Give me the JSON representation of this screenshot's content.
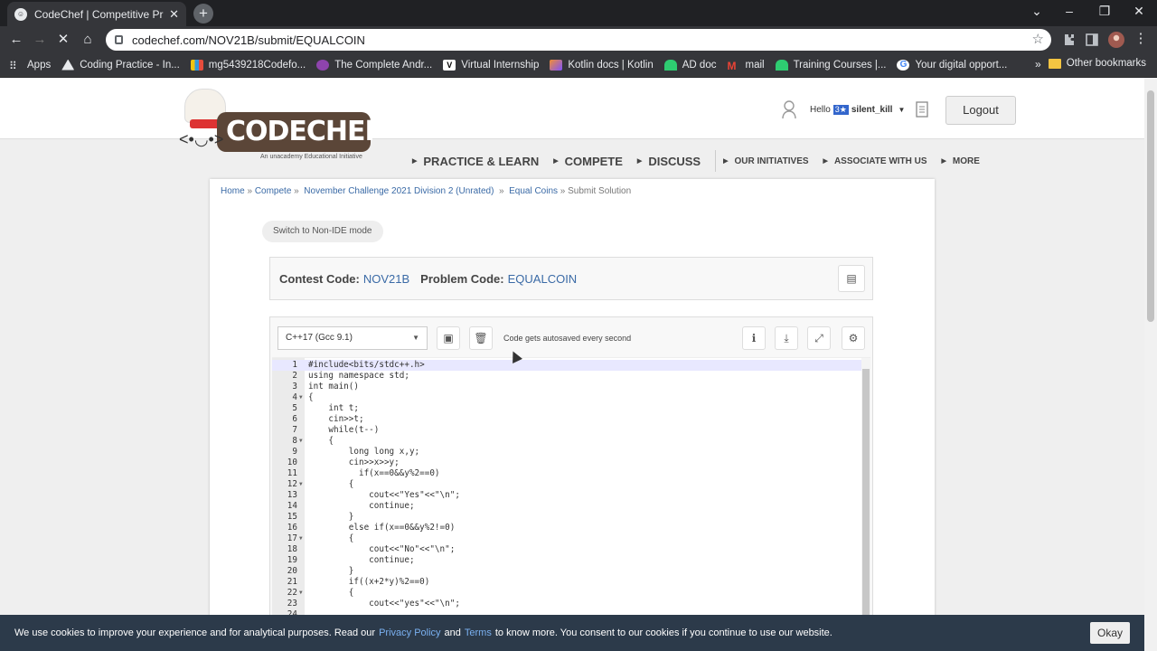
{
  "browser": {
    "tab_title": "CodeChef | Competitive Program",
    "url": "codechef.com/NOV21B/submit/EQUALCOIN",
    "bookmarks": [
      {
        "label": "Apps",
        "color": "#e8eaed"
      },
      {
        "label": "Coding Practice - In...",
        "color": "#e8eaed"
      },
      {
        "label": "mg5439218Codefo...",
        "color": "#e84c3d"
      },
      {
        "label": "The Complete Andr...",
        "color": "#8e44ad"
      },
      {
        "label": "Virtual Internship",
        "color": "#e8eaed"
      },
      {
        "label": "Kotlin docs | Kotlin",
        "color": "#7f52ff"
      },
      {
        "label": "AD doc",
        "color": "#2ecc71"
      },
      {
        "label": "mail",
        "color": "#ea4335"
      },
      {
        "label": "Training Courses  |...",
        "color": "#2ecc71"
      },
      {
        "label": "Your digital opport...",
        "color": "#4285f4"
      }
    ],
    "other_bookmarks": "Other bookmarks"
  },
  "header": {
    "logo_text": "CODECHEF",
    "logo_tagline": "An unacademy Educational Initiative",
    "hello": "Hello",
    "stars": "3★",
    "username": "silent_kill",
    "logout": "Logout"
  },
  "nav": {
    "practice": "PRACTICE & LEARN",
    "compete": "COMPETE",
    "discuss": "DISCUSS",
    "initiatives": "OUR INITIATIVES",
    "associate": "ASSOCIATE WITH US",
    "more": "MORE"
  },
  "breadcrumb": {
    "home": "Home",
    "compete": "Compete",
    "contest": "November Challenge 2021 Division 2 (Unrated)",
    "problem": "Equal Coins",
    "current": "Submit Solution"
  },
  "switch_mode": "Switch to Non-IDE mode",
  "contest": {
    "contest_label": "Contest Code:",
    "contest_code": "NOV21B",
    "problem_label": "Problem Code:",
    "problem_code": "EQUALCOIN"
  },
  "editor": {
    "language": "C++17 (Gcc 9.1)",
    "autosave": "Code gets autosaved every second",
    "lines": [
      {
        "n": "1",
        "fold": false,
        "src": "#include<bits/stdc++.h>"
      },
      {
        "n": "2",
        "fold": false,
        "src": "using namespace std;"
      },
      {
        "n": "3",
        "fold": false,
        "src": "int main()"
      },
      {
        "n": "4",
        "fold": true,
        "src": "{"
      },
      {
        "n": "5",
        "fold": false,
        "src": "    int t;"
      },
      {
        "n": "6",
        "fold": false,
        "src": "    cin>>t;"
      },
      {
        "n": "7",
        "fold": false,
        "src": "    while(t--)"
      },
      {
        "n": "8",
        "fold": true,
        "src": "    {"
      },
      {
        "n": "9",
        "fold": false,
        "src": "        long long x,y;"
      },
      {
        "n": "10",
        "fold": false,
        "src": "        cin>>x>>y;"
      },
      {
        "n": "11",
        "fold": false,
        "src": "          if(x==0&&y%2==0)"
      },
      {
        "n": "12",
        "fold": true,
        "src": "        {"
      },
      {
        "n": "13",
        "fold": false,
        "src": "            cout<<\"Yes\"<<\"\\n\";"
      },
      {
        "n": "14",
        "fold": false,
        "src": "            continue;"
      },
      {
        "n": "15",
        "fold": false,
        "src": "        }"
      },
      {
        "n": "16",
        "fold": false,
        "src": "        else if(x==0&&y%2!=0)"
      },
      {
        "n": "17",
        "fold": true,
        "src": "        {"
      },
      {
        "n": "18",
        "fold": false,
        "src": "            cout<<\"No\"<<\"\\n\";"
      },
      {
        "n": "19",
        "fold": false,
        "src": "            continue;"
      },
      {
        "n": "20",
        "fold": false,
        "src": "        }"
      },
      {
        "n": "21",
        "fold": false,
        "src": "        if((x+2*y)%2==0)"
      },
      {
        "n": "22",
        "fold": true,
        "src": "        {"
      },
      {
        "n": "23",
        "fold": false,
        "src": "            cout<<\"yes\"<<\"\\n\";"
      },
      {
        "n": "24",
        "fold": false,
        "src": ""
      }
    ]
  },
  "cookie": {
    "pre": "We use cookies to improve your experience and for analytical purposes. Read our",
    "privacy": "Privacy Policy",
    "and": "and",
    "terms": "Terms",
    "post": "to know more. You consent to our cookies if you continue to use our website.",
    "okay": "Okay"
  }
}
